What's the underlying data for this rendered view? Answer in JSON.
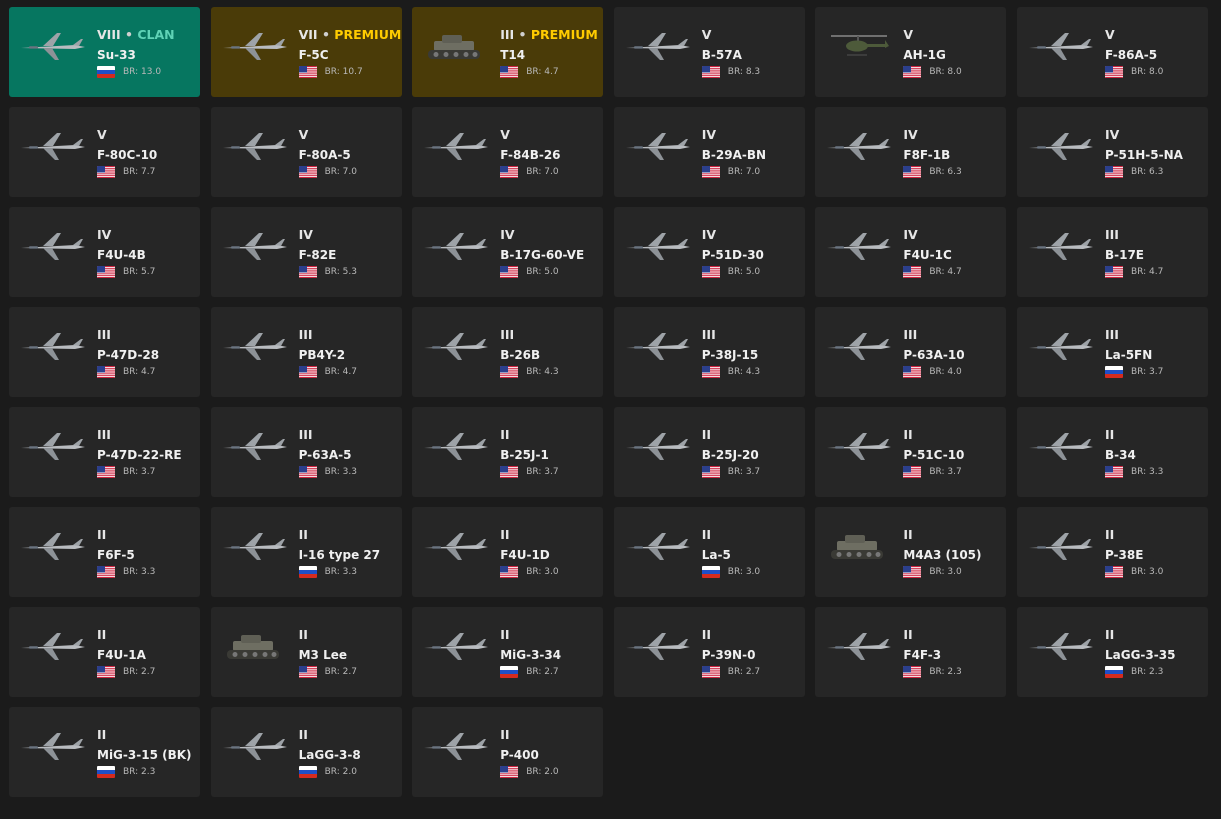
{
  "vehicles": [
    {
      "rank": "VIII",
      "tag": "CLAN",
      "name": "Su-33",
      "br": "BR: 13.0",
      "nation": "ru",
      "type": "plane"
    },
    {
      "rank": "VII",
      "tag": "PREMIUM",
      "name": "F-5C",
      "br": "BR: 10.7",
      "nation": "us",
      "type": "plane"
    },
    {
      "rank": "III",
      "tag": "PREMIUM",
      "name": "T14",
      "br": "BR: 4.7",
      "nation": "us",
      "type": "tank"
    },
    {
      "rank": "V",
      "tag": "",
      "name": "B-57A",
      "br": "BR: 8.3",
      "nation": "us",
      "type": "plane"
    },
    {
      "rank": "V",
      "tag": "",
      "name": "AH-1G",
      "br": "BR: 8.0",
      "nation": "us",
      "type": "heli"
    },
    {
      "rank": "V",
      "tag": "",
      "name": "F-86A-5",
      "br": "BR: 8.0",
      "nation": "us",
      "type": "plane"
    },
    {
      "rank": "V",
      "tag": "",
      "name": "F-80C-10",
      "br": "BR: 7.7",
      "nation": "us",
      "type": "plane"
    },
    {
      "rank": "V",
      "tag": "",
      "name": "F-80A-5",
      "br": "BR: 7.0",
      "nation": "us",
      "type": "plane"
    },
    {
      "rank": "V",
      "tag": "",
      "name": "F-84B-26",
      "br": "BR: 7.0",
      "nation": "us",
      "type": "plane"
    },
    {
      "rank": "IV",
      "tag": "",
      "name": "B-29A-BN",
      "br": "BR: 7.0",
      "nation": "us",
      "type": "plane"
    },
    {
      "rank": "IV",
      "tag": "",
      "name": "F8F-1B",
      "br": "BR: 6.3",
      "nation": "us",
      "type": "plane"
    },
    {
      "rank": "IV",
      "tag": "",
      "name": "P-51H-5-NA",
      "br": "BR: 6.3",
      "nation": "us",
      "type": "plane"
    },
    {
      "rank": "IV",
      "tag": "",
      "name": "F4U-4B",
      "br": "BR: 5.7",
      "nation": "us",
      "type": "plane"
    },
    {
      "rank": "IV",
      "tag": "",
      "name": "F-82E",
      "br": "BR: 5.3",
      "nation": "us",
      "type": "plane"
    },
    {
      "rank": "IV",
      "tag": "",
      "name": "B-17G-60-VE",
      "br": "BR: 5.0",
      "nation": "us",
      "type": "plane"
    },
    {
      "rank": "IV",
      "tag": "",
      "name": "P-51D-30",
      "br": "BR: 5.0",
      "nation": "us",
      "type": "plane"
    },
    {
      "rank": "IV",
      "tag": "",
      "name": "F4U-1C",
      "br": "BR: 4.7",
      "nation": "us",
      "type": "plane"
    },
    {
      "rank": "III",
      "tag": "",
      "name": "B-17E",
      "br": "BR: 4.7",
      "nation": "us",
      "type": "plane"
    },
    {
      "rank": "III",
      "tag": "",
      "name": "P-47D-28",
      "br": "BR: 4.7",
      "nation": "us",
      "type": "plane"
    },
    {
      "rank": "III",
      "tag": "",
      "name": "PB4Y-2",
      "br": "BR: 4.7",
      "nation": "us",
      "type": "plane"
    },
    {
      "rank": "III",
      "tag": "",
      "name": "B-26B",
      "br": "BR: 4.3",
      "nation": "us",
      "type": "plane"
    },
    {
      "rank": "III",
      "tag": "",
      "name": "P-38J-15",
      "br": "BR: 4.3",
      "nation": "us",
      "type": "plane"
    },
    {
      "rank": "III",
      "tag": "",
      "name": "P-63A-10",
      "br": "BR: 4.0",
      "nation": "us",
      "type": "plane"
    },
    {
      "rank": "III",
      "tag": "",
      "name": "La-5FN",
      "br": "BR: 3.7",
      "nation": "ru",
      "type": "plane"
    },
    {
      "rank": "III",
      "tag": "",
      "name": "P-47D-22-RE",
      "br": "BR: 3.7",
      "nation": "us",
      "type": "plane"
    },
    {
      "rank": "III",
      "tag": "",
      "name": "P-63A-5",
      "br": "BR: 3.3",
      "nation": "us",
      "type": "plane"
    },
    {
      "rank": "II",
      "tag": "",
      "name": "B-25J-1",
      "br": "BR: 3.7",
      "nation": "us",
      "type": "plane"
    },
    {
      "rank": "II",
      "tag": "",
      "name": "B-25J-20",
      "br": "BR: 3.7",
      "nation": "us",
      "type": "plane"
    },
    {
      "rank": "II",
      "tag": "",
      "name": "P-51C-10",
      "br": "BR: 3.7",
      "nation": "us",
      "type": "plane"
    },
    {
      "rank": "II",
      "tag": "",
      "name": "B-34",
      "br": "BR: 3.3",
      "nation": "us",
      "type": "plane"
    },
    {
      "rank": "II",
      "tag": "",
      "name": "F6F-5",
      "br": "BR: 3.3",
      "nation": "us",
      "type": "plane"
    },
    {
      "rank": "II",
      "tag": "",
      "name": "I-16 type 27",
      "br": "BR: 3.3",
      "nation": "ru",
      "type": "plane"
    },
    {
      "rank": "II",
      "tag": "",
      "name": "F4U-1D",
      "br": "BR: 3.0",
      "nation": "us",
      "type": "plane"
    },
    {
      "rank": "II",
      "tag": "",
      "name": "La-5",
      "br": "BR: 3.0",
      "nation": "ru",
      "type": "plane"
    },
    {
      "rank": "II",
      "tag": "",
      "name": "M4A3 (105)",
      "br": "BR: 3.0",
      "nation": "us",
      "type": "tank"
    },
    {
      "rank": "II",
      "tag": "",
      "name": "P-38E",
      "br": "BR: 3.0",
      "nation": "us",
      "type": "plane"
    },
    {
      "rank": "II",
      "tag": "",
      "name": "F4U-1A",
      "br": "BR: 2.7",
      "nation": "us",
      "type": "plane"
    },
    {
      "rank": "II",
      "tag": "",
      "name": "M3 Lee",
      "br": "BR: 2.7",
      "nation": "us",
      "type": "tank"
    },
    {
      "rank": "II",
      "tag": "",
      "name": "MiG-3-34",
      "br": "BR: 2.7",
      "nation": "ru",
      "type": "plane"
    },
    {
      "rank": "II",
      "tag": "",
      "name": "P-39N-0",
      "br": "BR: 2.7",
      "nation": "us",
      "type": "plane"
    },
    {
      "rank": "II",
      "tag": "",
      "name": "F4F-3",
      "br": "BR: 2.3",
      "nation": "us",
      "type": "plane"
    },
    {
      "rank": "II",
      "tag": "",
      "name": "LaGG-3-35",
      "br": "BR: 2.3",
      "nation": "ru",
      "type": "plane"
    },
    {
      "rank": "II",
      "tag": "",
      "name": "MiG-3-15 (BK)",
      "br": "BR: 2.3",
      "nation": "ru",
      "type": "plane"
    },
    {
      "rank": "II",
      "tag": "",
      "name": "LaGG-3-8",
      "br": "BR: 2.0",
      "nation": "ru",
      "type": "plane"
    },
    {
      "rank": "II",
      "tag": "",
      "name": "P-400",
      "br": "BR: 2.0",
      "nation": "us",
      "type": "plane"
    }
  ],
  "colors": {
    "clan_bg": "#067660",
    "premium_bg": "#4a3b08",
    "card_bg": "#262626",
    "clan_text": "#5fd3b6",
    "premium_text": "#ffcc00"
  },
  "separator": "•"
}
